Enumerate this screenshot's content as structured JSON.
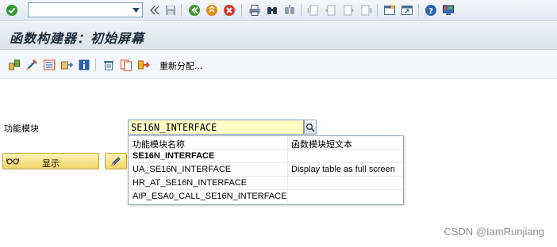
{
  "window": {
    "title": "函数构建器：初始屏幕"
  },
  "command_field": {
    "value": ""
  },
  "app_toolbar": {
    "reassign_label": "重新分配..."
  },
  "main": {
    "function_module_label": "功能模块",
    "function_module_value": "SE16N_INTERFACE",
    "display_button_label": "显示"
  },
  "value_help": {
    "headers": {
      "name": "功能模块名称",
      "short_text": "函数模块短文本"
    },
    "rows": [
      {
        "name": "SE16N_INTERFACE",
        "short_text": "",
        "emphasized": true
      },
      {
        "name": "UA_SE16N_INTERFACE",
        "short_text": "Display table as full screen",
        "emphasized": false
      },
      {
        "name": "HR_AT_SE16N_INTERFACE",
        "short_text": "",
        "emphasized": false
      },
      {
        "name": "AIP_ESA0_CALL_SE16N_INTERFACE",
        "short_text": "",
        "emphasized": false
      }
    ]
  },
  "watermark": "CSDN @IamRunjiang",
  "icons": {
    "system": [
      "enter-check-icon",
      "save-icon",
      "back-icon",
      "exit-icon",
      "cancel-icon",
      "print-icon",
      "find-icon",
      "find-next-icon",
      "first-page-icon",
      "previous-page-icon",
      "next-page-icon",
      "last-page-icon",
      "create-session-icon",
      "shortcut-icon",
      "help-icon",
      "customize-layout-icon"
    ],
    "application": [
      "other-object-icon",
      "test-icon",
      "where-used-icon",
      "copy-icon",
      "info-icon",
      "delete-icon",
      "rename-icon",
      "reassign-icon"
    ]
  },
  "colors": {
    "required_field_bg": "#ffffc6",
    "button_yellow": "#f3d466",
    "check_green": "#2f9a2f",
    "exit_orange": "#e06a1a",
    "cancel_red": "#d23a2a",
    "help_blue": "#2767b0"
  }
}
